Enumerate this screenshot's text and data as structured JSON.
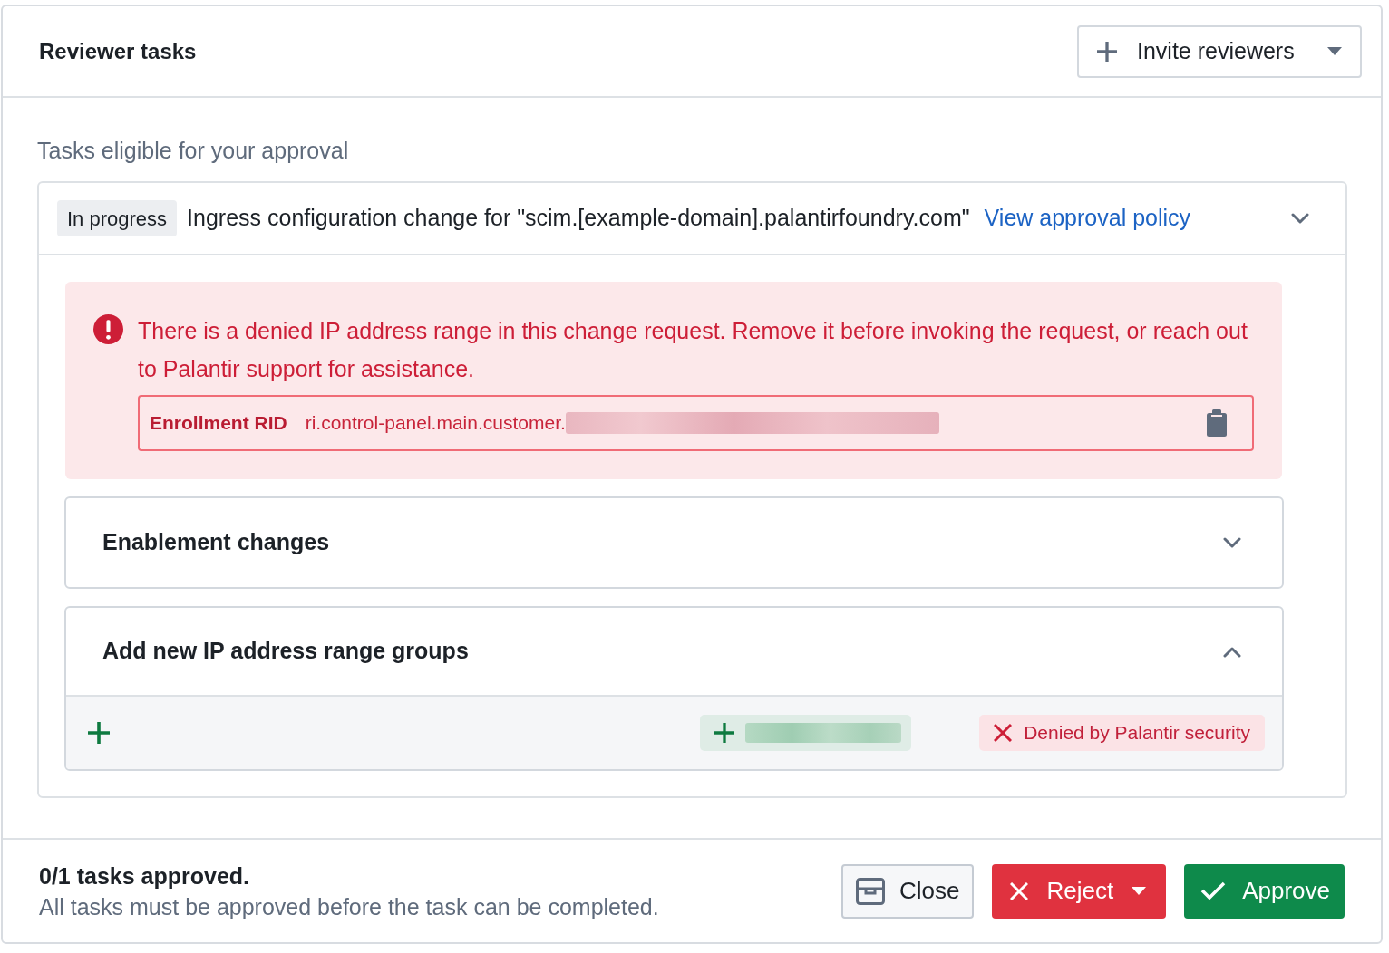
{
  "header": {
    "title": "Reviewer tasks",
    "invite_button": "Invite reviewers"
  },
  "section_label": "Tasks eligible for your approval",
  "task": {
    "status": "In progress",
    "title": "Ingress configuration change for \"scim.[example-domain].palantirfoundry.com\"",
    "link": "View approval policy",
    "expanded": true,
    "error": {
      "message": "There is a denied IP address range in this change request. Remove it before invoking the request, or reach out to Palantir support for assistance.",
      "field_label": "Enrollment RID",
      "field_value": "ri.control-panel.main.customer."
    },
    "groups": [
      {
        "title": "Enablement changes",
        "expanded": false
      },
      {
        "title": "Add new IP address range groups",
        "expanded": true,
        "rows": [
          {
            "denied": true,
            "status": "Denied by Palantir security"
          }
        ]
      }
    ]
  },
  "footer": {
    "summary": "0/1 tasks approved.",
    "note": "All tasks must be approved before the task can be completed.",
    "buttons": [
      {
        "kind": "close",
        "label": "Close"
      },
      {
        "kind": "reject",
        "label": "Reject"
      },
      {
        "kind": "approve",
        "label": "Approve"
      }
    ]
  }
}
